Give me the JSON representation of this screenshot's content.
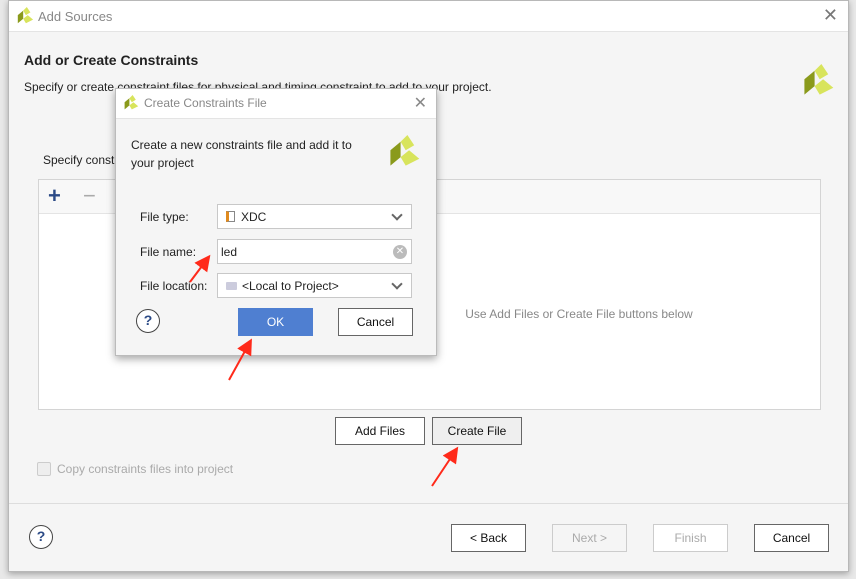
{
  "main": {
    "title": "Add Sources",
    "heading": "Add or Create Constraints",
    "description": "Specify or create constraint files for physical and timing constraint to add to your project.",
    "specify_label": "Specify constraint files to create, or add existing files.",
    "table_hint": "Use Add Files or Create File buttons below",
    "add_files": "Add Files",
    "create_file": "Create File",
    "copy_checkbox": "Copy constraints files into project",
    "copy_checked": false,
    "back": "< Back",
    "next": "Next >",
    "finish": "Finish",
    "cancel": "Cancel",
    "help": "?"
  },
  "sub": {
    "title": "Create Constraints File",
    "description": "Create a new constraints file and add it to your project",
    "file_type_label": "File type:",
    "file_type": "XDC",
    "file_name_label": "File name:",
    "file_name": "led",
    "file_location_label": "File location:",
    "file_location": "<Local to Project>",
    "ok": "OK",
    "cancel": "Cancel",
    "help": "?"
  },
  "colors": {
    "accent": "#4f7fd1",
    "annotation_arrow": "#ff2a1a",
    "logo_dark": "#8a9a1b",
    "logo_light": "#d8e45c"
  }
}
